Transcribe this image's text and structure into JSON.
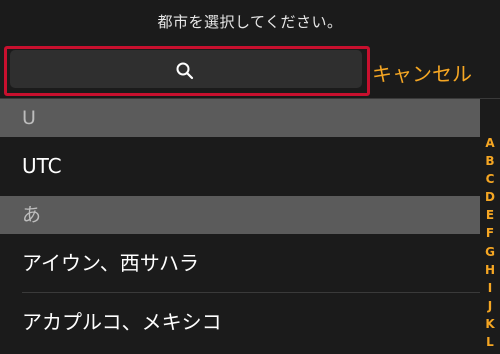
{
  "header": {
    "prompt": "都市を選択してください。"
  },
  "search": {
    "icon": "search-icon",
    "placeholder": "",
    "highlight_color": "#c8102e"
  },
  "cancel": {
    "label": "キャンセル"
  },
  "colors": {
    "accent": "#f5a623",
    "background": "#1b1b1b",
    "section_header_bg": "#5b5b5b"
  },
  "sections": [
    {
      "header": "U",
      "cities": [
        "UTC"
      ]
    },
    {
      "header": "あ",
      "cities": [
        "アイウン、西サハラ",
        "アカプルコ、メキシコ"
      ]
    }
  ],
  "index_letters": [
    "A",
    "B",
    "C",
    "D",
    "E",
    "F",
    "G",
    "H",
    "I",
    "J",
    "K",
    "L"
  ]
}
